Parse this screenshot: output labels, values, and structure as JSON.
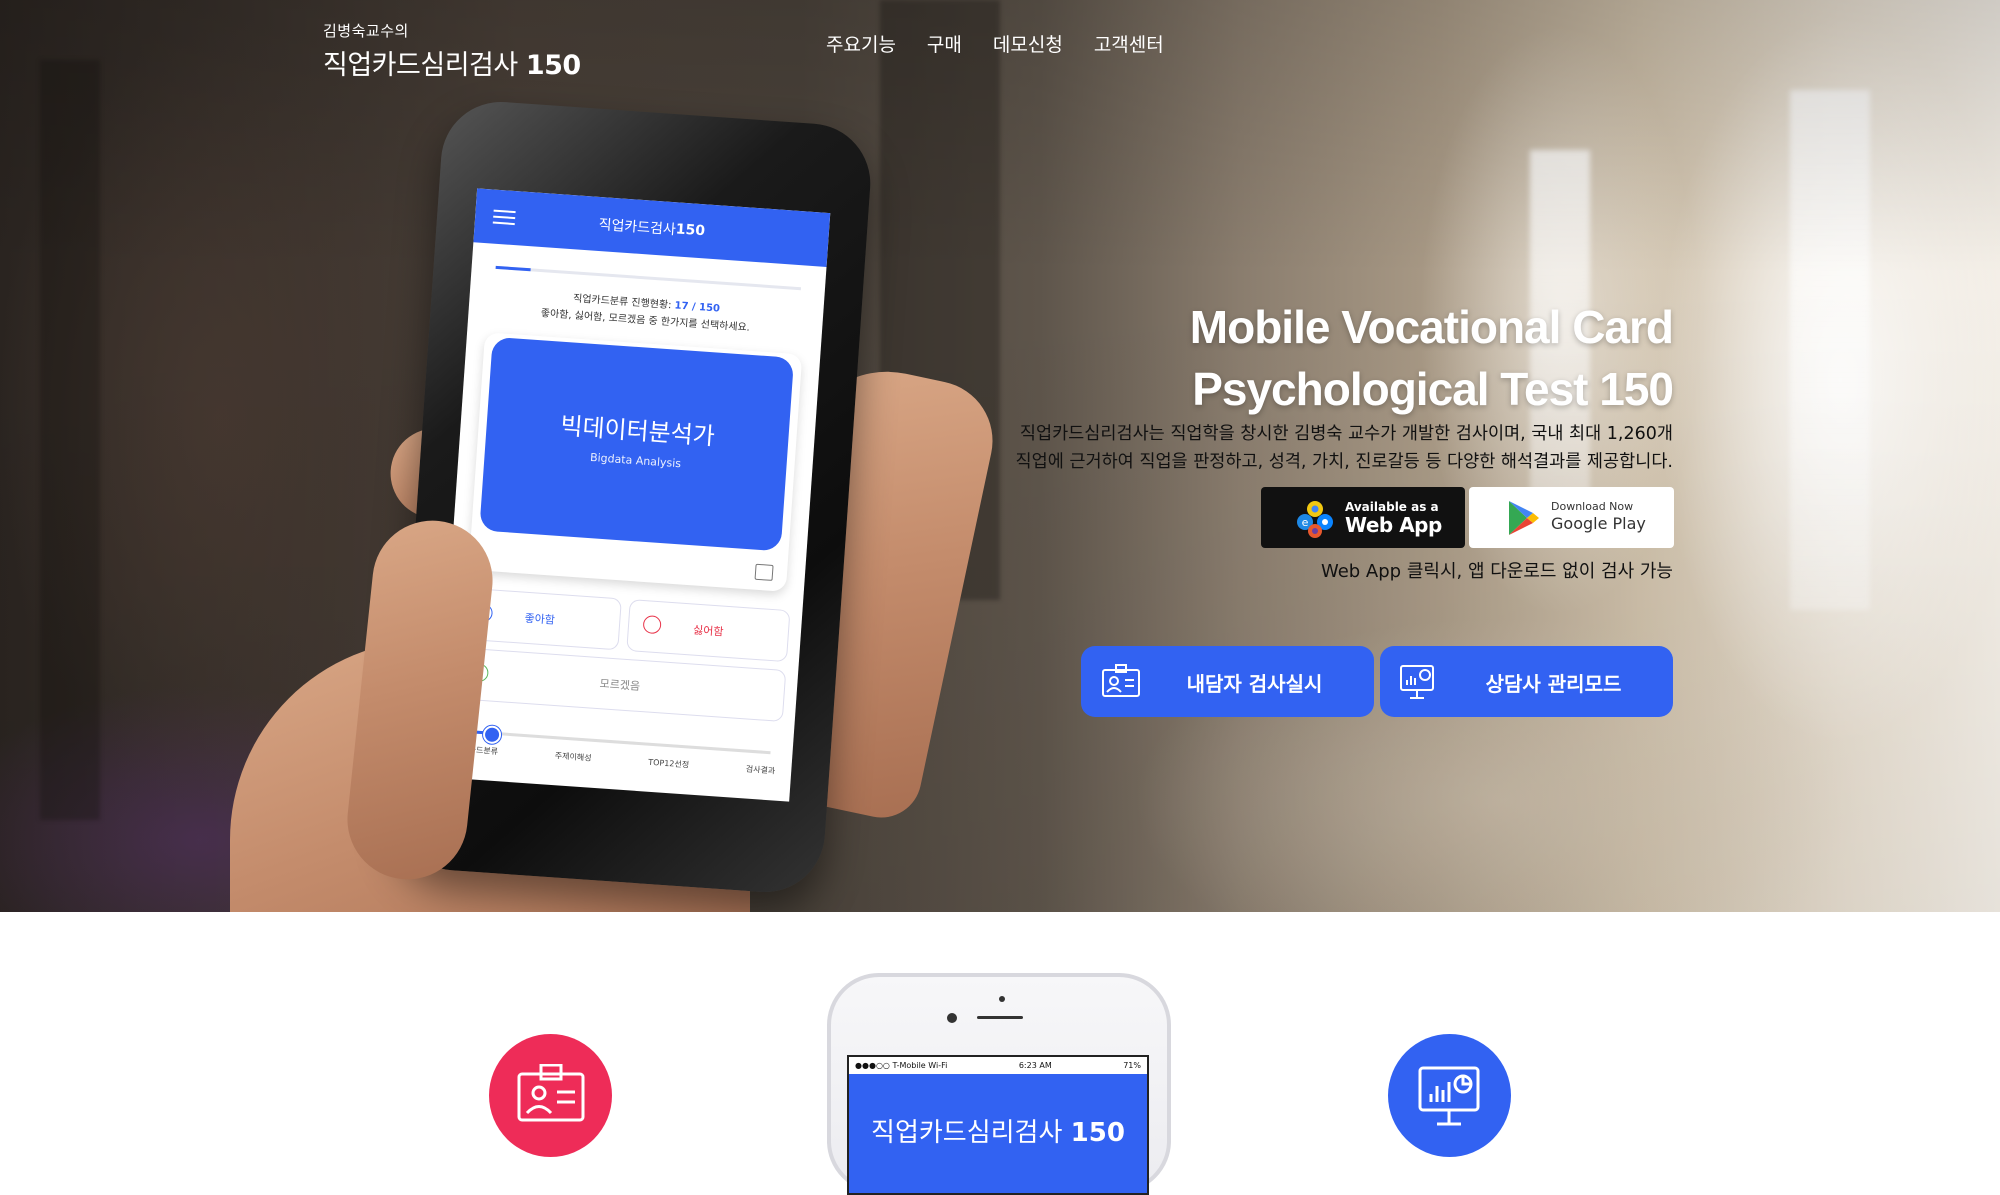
{
  "brand": {
    "subtitle": "김병숙교수의",
    "title": "직업카드심리검사",
    "number": "150"
  },
  "nav": [
    "주요기능",
    "구매",
    "데모신청",
    "고객센터"
  ],
  "hero": {
    "title_line1": "Mobile Vocational Card",
    "title_line2": "Psychological Test 150",
    "desc_line1": "직업카드심리검사는 직업학을 창시한 김병숙 교수가 개발한 검사이며, 국내 최대 1,260개",
    "desc_line2": "직업에 근거하여 직업을 판정하고, 성격, 가치, 진로갈등 등 다양한 해석결과를 제공합니다.",
    "webapp_badge": {
      "line1": "Available as a",
      "line2": "Web App"
    },
    "play_badge": {
      "line1": "Download Now",
      "line2": "Google Play"
    },
    "webapp_note": "Web App 클릭시, 앱 다운로드 없이 검사 가능",
    "cta_client": "내담자 검사실시",
    "cta_counselor": "상담사 관리모드"
  },
  "phone_app": {
    "bar_title": "직업카드검사",
    "bar_number": "150",
    "progress_label": "직업카드분류 진행현황: ",
    "progress_count": "17 / 150",
    "progress_fraction": 0.113,
    "instruction": "좋아함, 싫어함, 모르겠음 중 한가지를 선택하세요.",
    "card_korean": "빅데이터분석가",
    "card_english": "Bigdata Analysis",
    "like": "좋아함",
    "dislike": "싫어함",
    "unknown": "모르겠음",
    "steps": [
      "직업카드분류",
      "주제이해성",
      "TOP12선정",
      "검사결과"
    ]
  },
  "phone_preview": {
    "carrier": "●●●○○ T-Mobile Wi-Fi",
    "time": "6:23 AM",
    "battery": "71%",
    "title": "직업카드심리검사",
    "number": "150"
  },
  "colors": {
    "primary": "#3262f2",
    "accent_pink": "#ee2c58"
  }
}
